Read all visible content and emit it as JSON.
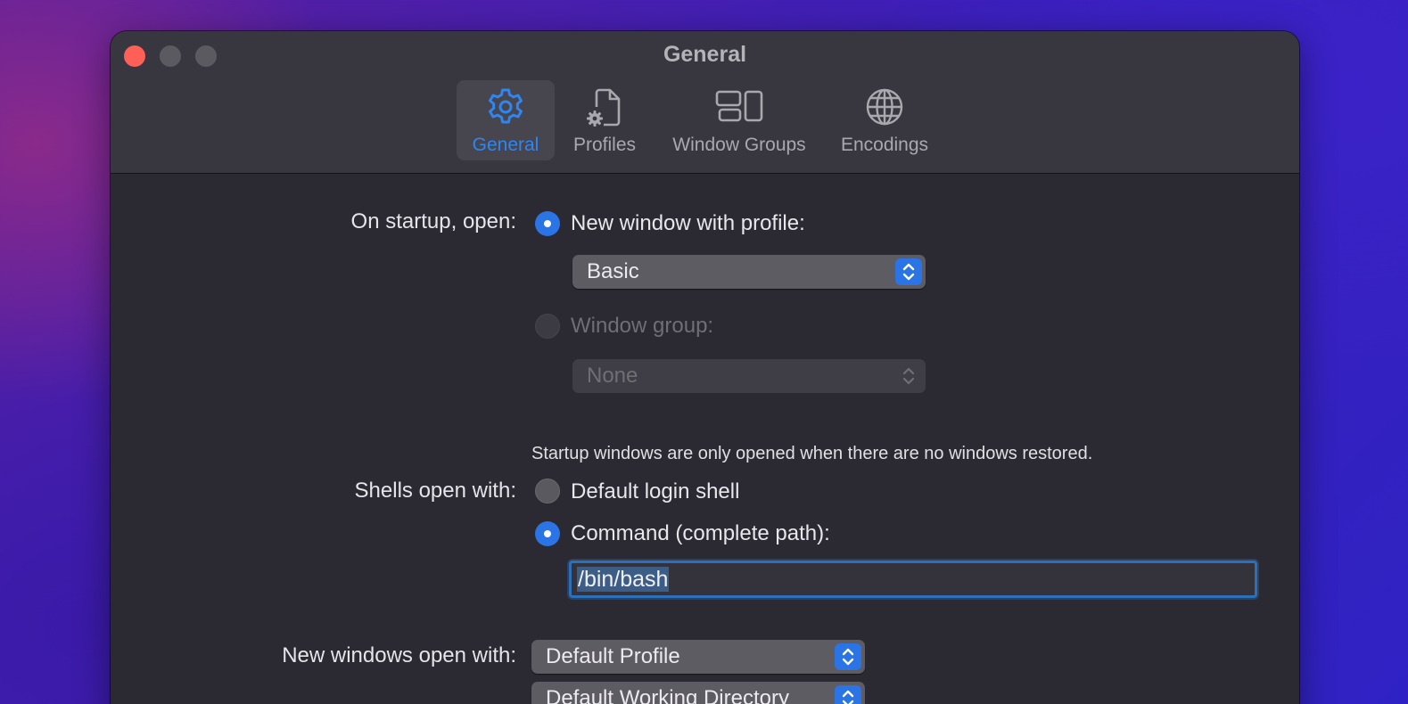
{
  "window": {
    "title": "General"
  },
  "toolbar": {
    "tabs": [
      {
        "label": "General",
        "icon": "gear-icon",
        "selected": true
      },
      {
        "label": "Profiles",
        "icon": "profile-document-icon",
        "selected": false
      },
      {
        "label": "Window Groups",
        "icon": "window-groups-icon",
        "selected": false
      },
      {
        "label": "Encodings",
        "icon": "globe-icon",
        "selected": false
      }
    ]
  },
  "startup": {
    "label": "On startup, open:",
    "new_window_option": "New window with profile:",
    "new_window_selected": true,
    "profile_popup_value": "Basic",
    "window_group_option": "Window group:",
    "window_group_selected": false,
    "window_group_popup_value": "None",
    "note": "Startup windows are only opened when there are no windows restored."
  },
  "shells": {
    "label": "Shells open with:",
    "default_login_option": "Default login shell",
    "default_login_selected": false,
    "command_option": "Command (complete path):",
    "command_selected": true,
    "command_value": "/bin/bash"
  },
  "new_windows": {
    "label": "New windows open with:",
    "profile_popup_value": "Default Profile",
    "directory_popup_value": "Default Working Directory"
  },
  "colors": {
    "accent": "#2a74e6",
    "selected_tab_text": "#2f86f0",
    "close_button": "#fe5f57"
  }
}
